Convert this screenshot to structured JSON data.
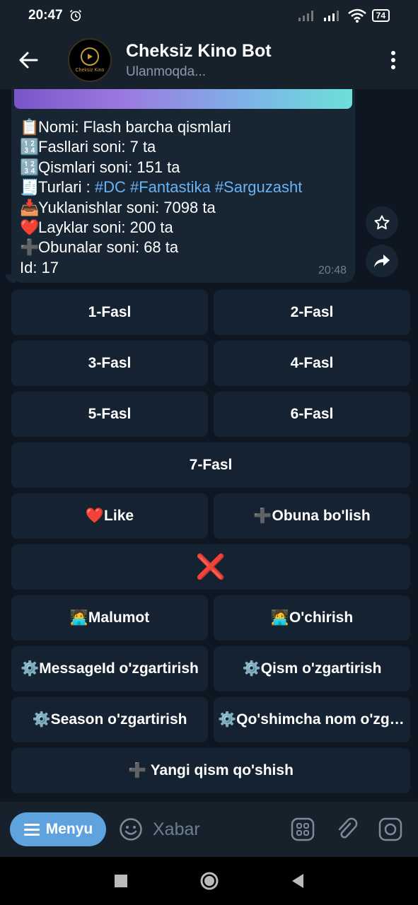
{
  "status": {
    "time": "20:47",
    "battery": "74"
  },
  "header": {
    "title": "Cheksiz Kino Bot",
    "subtitle": "Ulanmoqda...",
    "avatar_text": "Cheksiz Kino"
  },
  "message": {
    "lines": [
      {
        "emoji": "📋",
        "text": "Nomi: Flash barcha qismlari"
      },
      {
        "emoji": "🔢",
        "text": "Fasllari soni: 7 ta"
      },
      {
        "emoji": "🔢",
        "text": "Qismlari soni: 151 ta"
      },
      {
        "emoji": "🧾",
        "text": "Turlari : ",
        "tags": "#DC #Fantastika #Sarguzasht"
      },
      {
        "emoji": "📥",
        "text": "Yuklanishlar soni: 7098 ta"
      },
      {
        "emoji": "❤️",
        "text": "Layklar soni: 200 ta"
      },
      {
        "emoji": "➕",
        "text": "Obunalar soni: 68 ta"
      },
      {
        "emoji": "",
        "text": "Id: 17"
      }
    ],
    "time": "20:48"
  },
  "keyboard": {
    "fasl1": "1-Fasl",
    "fasl2": "2-Fasl",
    "fasl3": "3-Fasl",
    "fasl4": "4-Fasl",
    "fasl5": "5-Fasl",
    "fasl6": "6-Fasl",
    "fasl7": "7-Fasl",
    "like": "❤️Like",
    "obuna": "➕Obuna bo'lish",
    "close": "❌",
    "malumot": "🧑‍💻Malumot",
    "ochirish": "🧑‍💻O'chirish",
    "messageid": "⚙️MessageId o'zgartirish",
    "qism": "⚙️Qism o'zgartirish",
    "season": "⚙️Season o'zgartirish",
    "qoshimcha": "⚙️Qo'shimcha nom o'zgartirish",
    "yangi": "➕ Yangi qism qo'shish"
  },
  "input": {
    "menu_label": "Menyu",
    "placeholder": "Xabar"
  },
  "colors": {
    "bg": "#0e1621",
    "bubble": "#182533",
    "accent": "#5fa3de",
    "link": "#6ab3f3"
  }
}
